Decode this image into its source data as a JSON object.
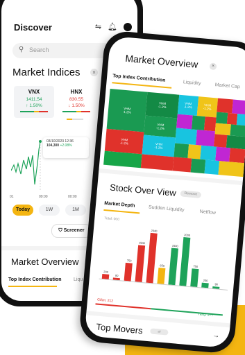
{
  "left_phone": {
    "title": "Discover",
    "search_placeholder": "Search",
    "section_title": "Market Indices",
    "indices": [
      {
        "name": "VNX",
        "value": "1411.54",
        "change": "1.50%",
        "direction": "up",
        "color": "#1ea35a"
      },
      {
        "name": "HNX",
        "value": "830.55",
        "change": "1.50%",
        "direction": "down",
        "color": "#e0322b"
      }
    ],
    "tooltip": {
      "date": "03/10/2023 12:36",
      "value": "104,300",
      "change": "+2.08%"
    },
    "x_axis": [
      "01",
      "09:00",
      "00:00"
    ],
    "ranges": [
      "Today",
      "1W",
      "1M"
    ],
    "screener_label": "Screener",
    "market_overview_title": "Market Overview",
    "tabs": [
      "Top Index Contribution",
      "Liqu"
    ]
  },
  "right_phone": {
    "title": "Market Overview",
    "tabs": [
      "Top Index Contribution",
      "Liquidity",
      "Market Cap"
    ],
    "treemap_label": "VHM",
    "treemap_change": "-1.2%",
    "stock_overview_title": "Stock Over View",
    "remove_label": "Remove",
    "depth_tabs": [
      "Market Depth",
      "Sudden Liquidity",
      "Netflow"
    ],
    "total_label": "Total: 000",
    "sell_label": "Giảm: 212",
    "buy_label": "Tăng: 277",
    "top_movers_title": "Top Movers",
    "top_movers_badge": "all",
    "colors": {
      "accent": "#f4b511",
      "green": "#1ea35a",
      "red": "#e0322b"
    }
  },
  "chart_data": {
    "type": "bar",
    "title": "Market Depth",
    "values": [
      200,
      80,
      750,
      1500,
      2040,
      650,
      1500,
      2000,
      750,
      200,
      90
    ],
    "colors": [
      "#e0322b",
      "#e0322b",
      "#e0322b",
      "#e0322b",
      "#e0322b",
      "#f4b511",
      "#1ea35a",
      "#1ea35a",
      "#1ea35a",
      "#1ea35a",
      "#1ea35a"
    ],
    "labels": [
      "200",
      "80",
      "750",
      "1500",
      "2040",
      "650",
      "1500",
      "2000",
      "750",
      "200",
      "90"
    ]
  }
}
